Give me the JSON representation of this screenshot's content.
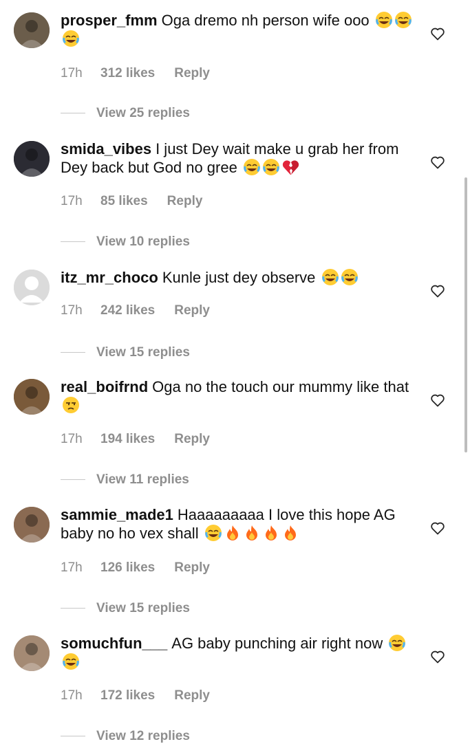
{
  "comments": [
    {
      "username": "prosper_fmm",
      "text": "Oga dremo nh person wife ooo",
      "emojis": [
        "laugh",
        "laugh",
        "laugh"
      ],
      "time": "17h",
      "likes": "312 likes",
      "reply": "Reply",
      "view_replies": "View 25 replies",
      "avatar_color": "#6b5d4b"
    },
    {
      "username": "smida_vibes",
      "text": "I just Dey wait make u grab her from Dey back but God no gree",
      "emojis": [
        "laugh",
        "laugh",
        "broken-heart"
      ],
      "time": "17h",
      "likes": "85 likes",
      "reply": "Reply",
      "view_replies": "View 10 replies",
      "avatar_color": "#2b2b33"
    },
    {
      "username": "itz_mr_choco",
      "text": "Kunle just dey observe",
      "emojis": [
        "laugh",
        "laugh"
      ],
      "time": "17h",
      "likes": "242 likes",
      "reply": "Reply",
      "view_replies": "View 15 replies",
      "avatar_color": "#dbdbdb"
    },
    {
      "username": "real_boifrnd",
      "text": "Oga no the touch our mummy like that",
      "emojis": [
        "unamused"
      ],
      "time": "17h",
      "likes": "194 likes",
      "reply": "Reply",
      "view_replies": "View 11 replies",
      "avatar_color": "#7a5a3a"
    },
    {
      "username": "sammie_made1",
      "text": "Haaaaaaaaa I love this hope AG baby no ho vex shall",
      "emojis": [
        "laugh",
        "fire",
        "fire",
        "fire",
        "fire"
      ],
      "time": "17h",
      "likes": "126 likes",
      "reply": "Reply",
      "view_replies": "View 15 replies",
      "avatar_color": "#8a6a52"
    },
    {
      "username": "somuchfun___",
      "text": "AG baby punching air right now",
      "emojis": [
        "laugh",
        "laugh"
      ],
      "time": "17h",
      "likes": "172 likes",
      "reply": "Reply",
      "view_replies": "View 12 replies",
      "avatar_color": "#a48a74"
    }
  ],
  "icons": {
    "heart": "heart-outline-icon",
    "laugh": "face-with-tears-of-joy-emoji",
    "broken-heart": "broken-heart-emoji",
    "fire": "fire-emoji",
    "unamused": "unamused-face-emoji"
  },
  "colors": {
    "meta_text": "#8e8e8e",
    "username": "#111111",
    "divider": "#c7c7c7"
  }
}
